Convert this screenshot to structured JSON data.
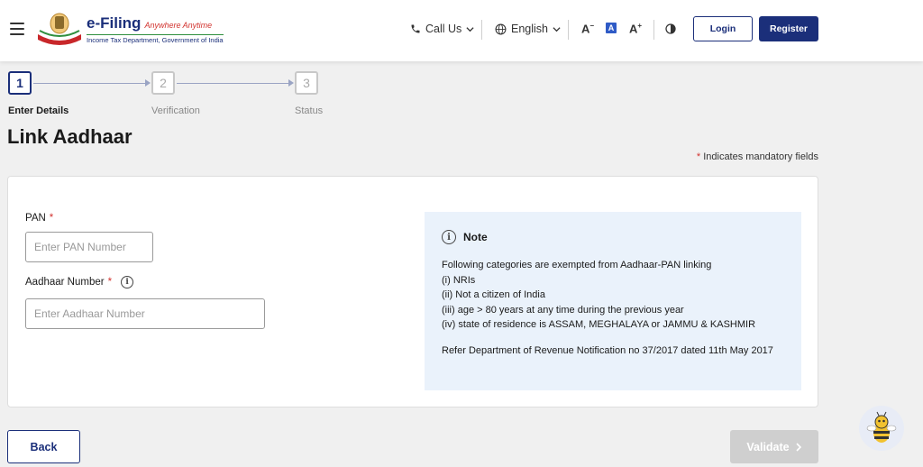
{
  "header": {
    "logo_title": "e-Filing",
    "logo_tagline": "Anywhere Anytime",
    "logo_subtitle": "Income Tax Department, Government of India",
    "call_us": "Call Us",
    "language": "English",
    "font_decrease": "A",
    "font_default": "A",
    "font_increase": "A",
    "login_label": "Login",
    "register_label": "Register"
  },
  "stepper": {
    "steps": [
      {
        "number": "1",
        "label": "Enter Details",
        "active": true
      },
      {
        "number": "2",
        "label": "Verification",
        "active": false
      },
      {
        "number": "3",
        "label": "Status",
        "active": false
      }
    ]
  },
  "page": {
    "title": "Link Aadhaar",
    "mandatory_star": "*",
    "mandatory_note": "Indicates mandatory fields"
  },
  "form": {
    "pan_label": "PAN",
    "pan_placeholder": "Enter PAN Number",
    "aadhaar_label": "Aadhaar Number",
    "aadhaar_placeholder": "Enter Aadhaar Number",
    "required_star": "*"
  },
  "note": {
    "title": "Note",
    "intro": "Following categories are exempted from Aadhaar-PAN linking",
    "items": [
      "(i) NRIs",
      "(ii) Not a citizen of India",
      "(iii) age > 80 years at any time during the previous year",
      "(iv) state of residence is ASSAM, MEGHALAYA or JAMMU & KASHMIR"
    ],
    "reference": "Refer Department of Revenue Notification no 37/2017 dated 11th May 2017"
  },
  "actions": {
    "back_label": "Back",
    "validate_label": "Validate"
  },
  "colors": {
    "brand": "#1b2f7a",
    "required": "#d2332f",
    "note_bg": "#eaf2fb",
    "disabled": "#cfcfcf"
  }
}
